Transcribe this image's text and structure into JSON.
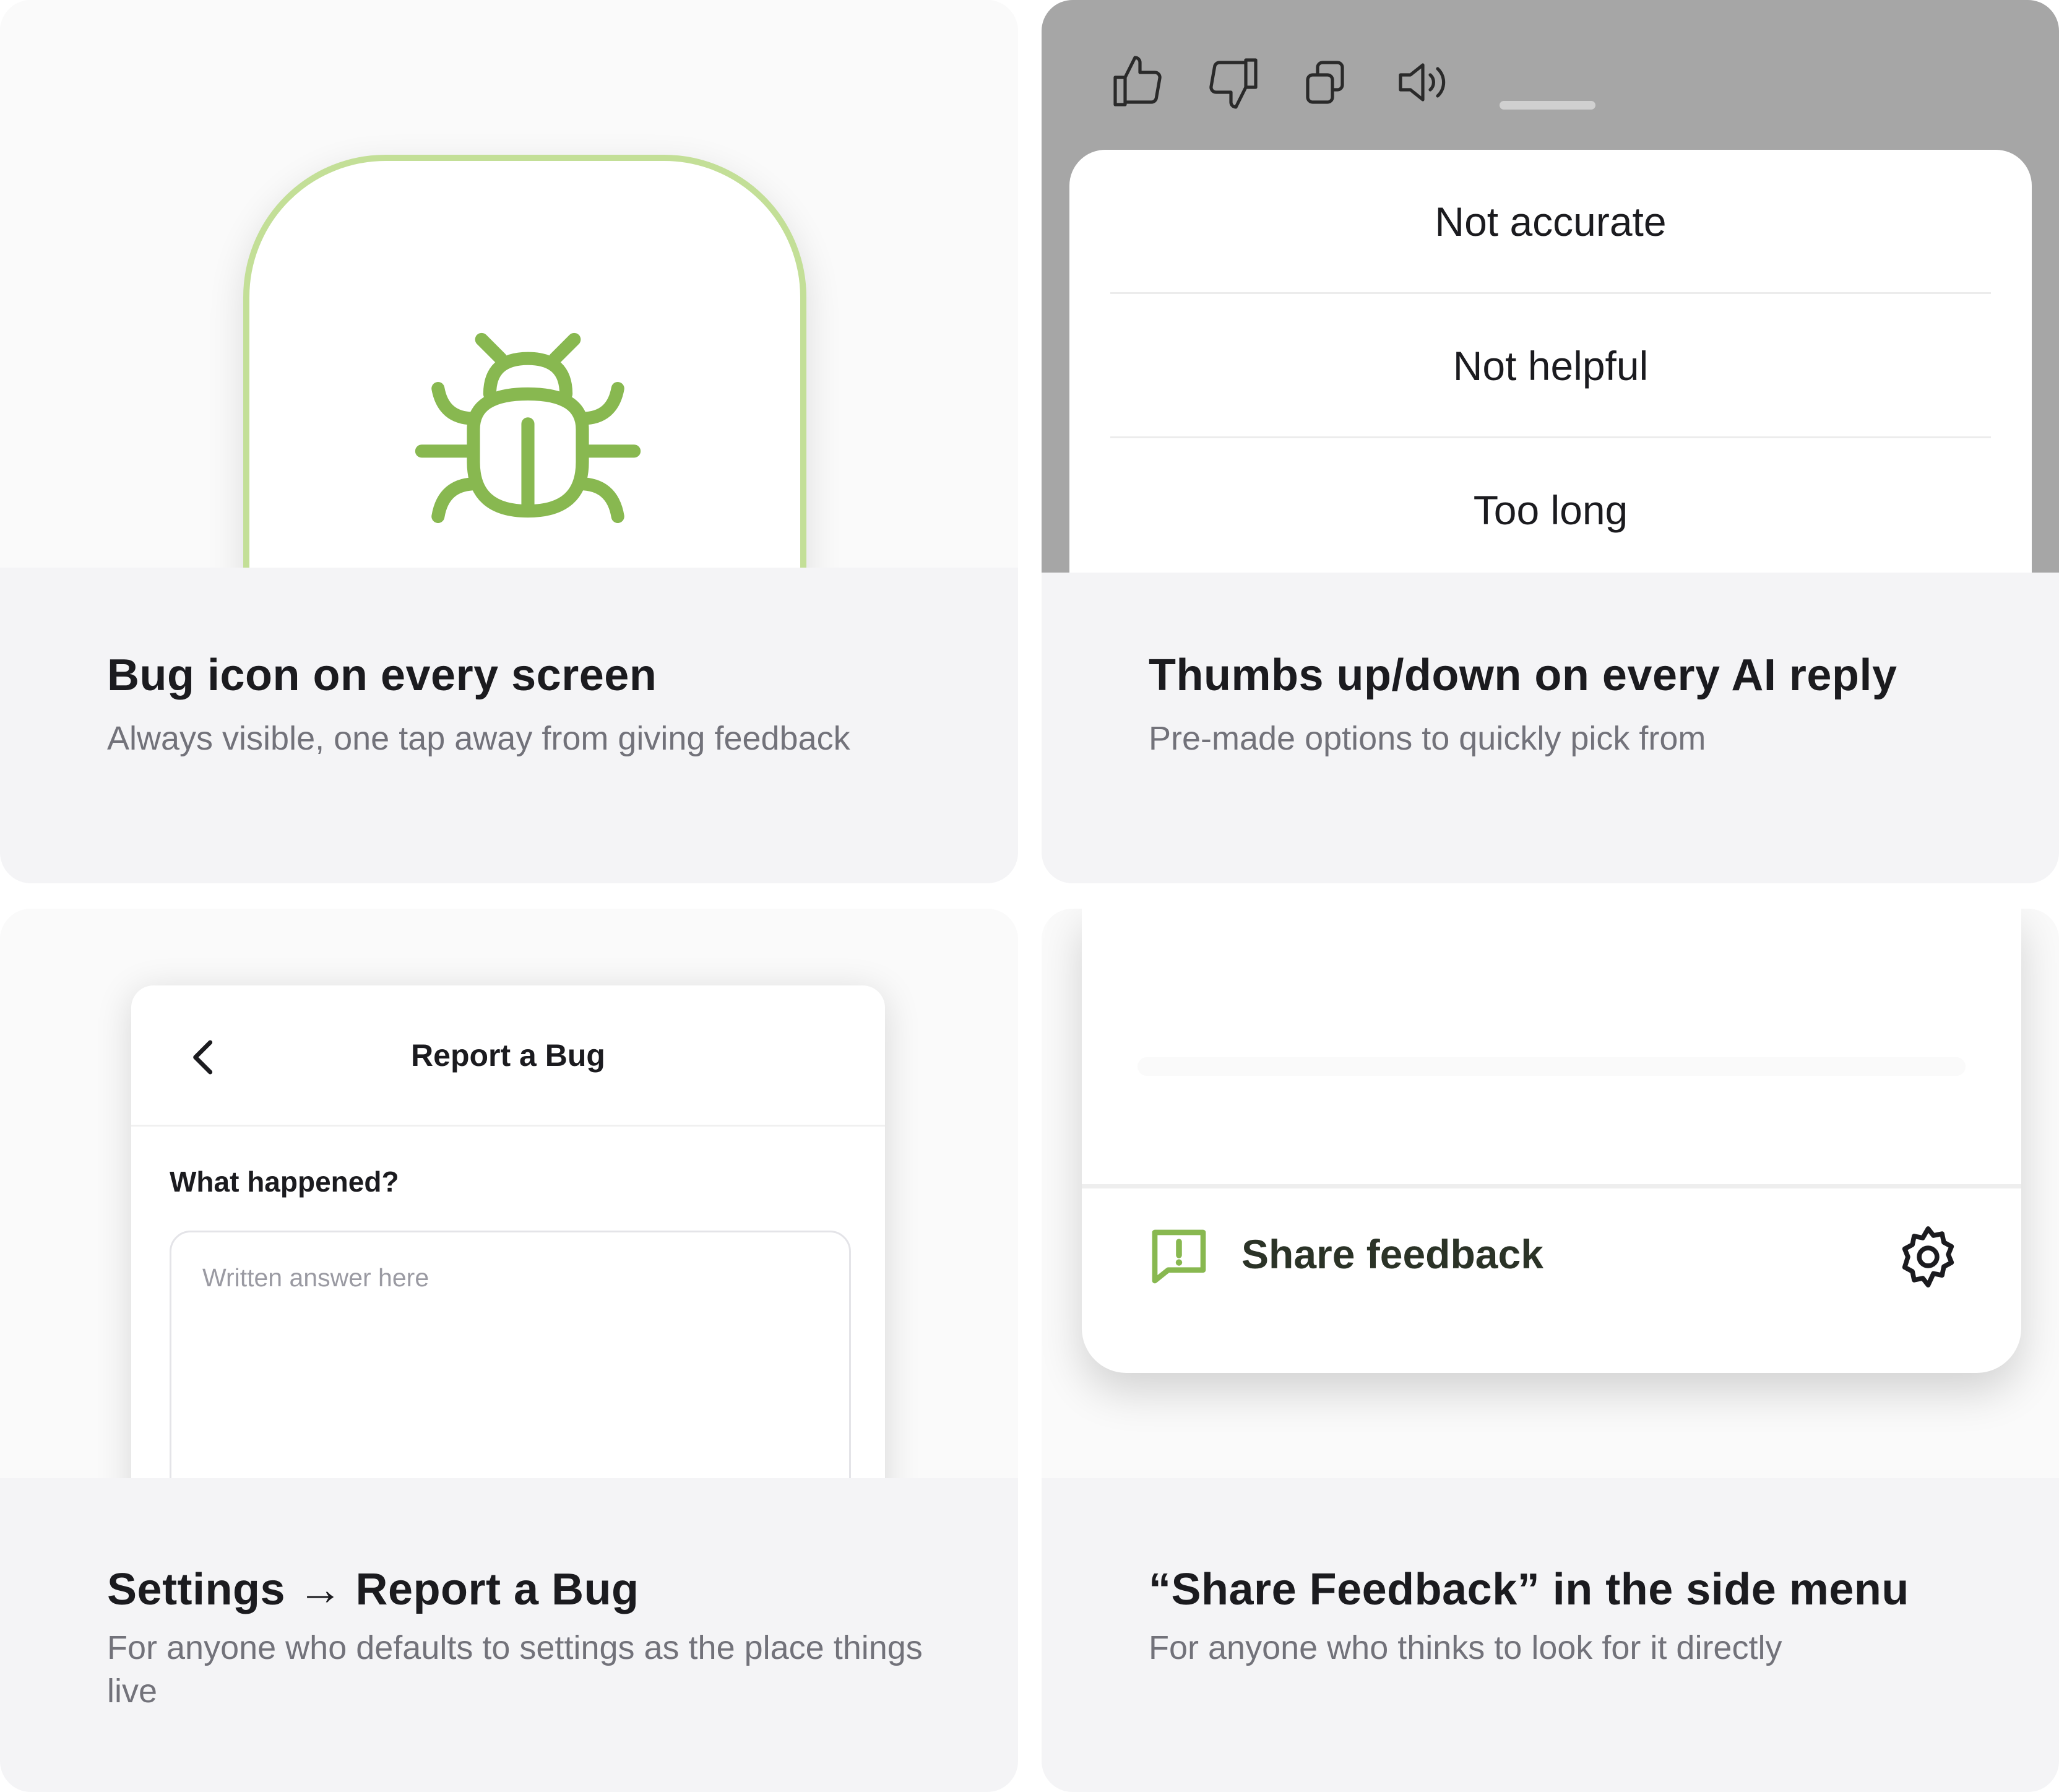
{
  "colors": {
    "accent_green": "#88b850",
    "accent_green_light": "#c3df97",
    "title_text": "#1b1b1f",
    "subtitle_text": "#72727a",
    "card_bg": "#f4f4f6",
    "overlay_gray": "#a6a6a6"
  },
  "cards": [
    {
      "title": "Bug icon on every screen",
      "subtitle": "Always visible, one tap away from giving feedback",
      "visual": {
        "icon": "bug-icon"
      }
    },
    {
      "title": "Thumbs up/down on every AI reply",
      "subtitle": "Pre-made options to quickly pick from",
      "visual": {
        "toolbar_icons": [
          "thumbs-up-icon",
          "thumbs-down-icon",
          "copy-icon",
          "speaker-icon"
        ],
        "options": [
          "Not accurate",
          "Not helpful",
          "Too long"
        ]
      }
    },
    {
      "title": "Settings → Report a Bug",
      "subtitle": "For anyone who defaults to settings as the place things live",
      "visual": {
        "screen_title": "Report a Bug",
        "field_label": "What happened?",
        "placeholder": "Written answer here",
        "back_icon": "chevron-left-icon"
      }
    },
    {
      "title": "“Share Feedback” in the side menu",
      "subtitle": "For anyone who thinks to look for it directly",
      "visual": {
        "menu_item": "Share feedback",
        "menu_icon": "feedback-alert-icon",
        "settings_icon": "gear-icon"
      }
    }
  ]
}
